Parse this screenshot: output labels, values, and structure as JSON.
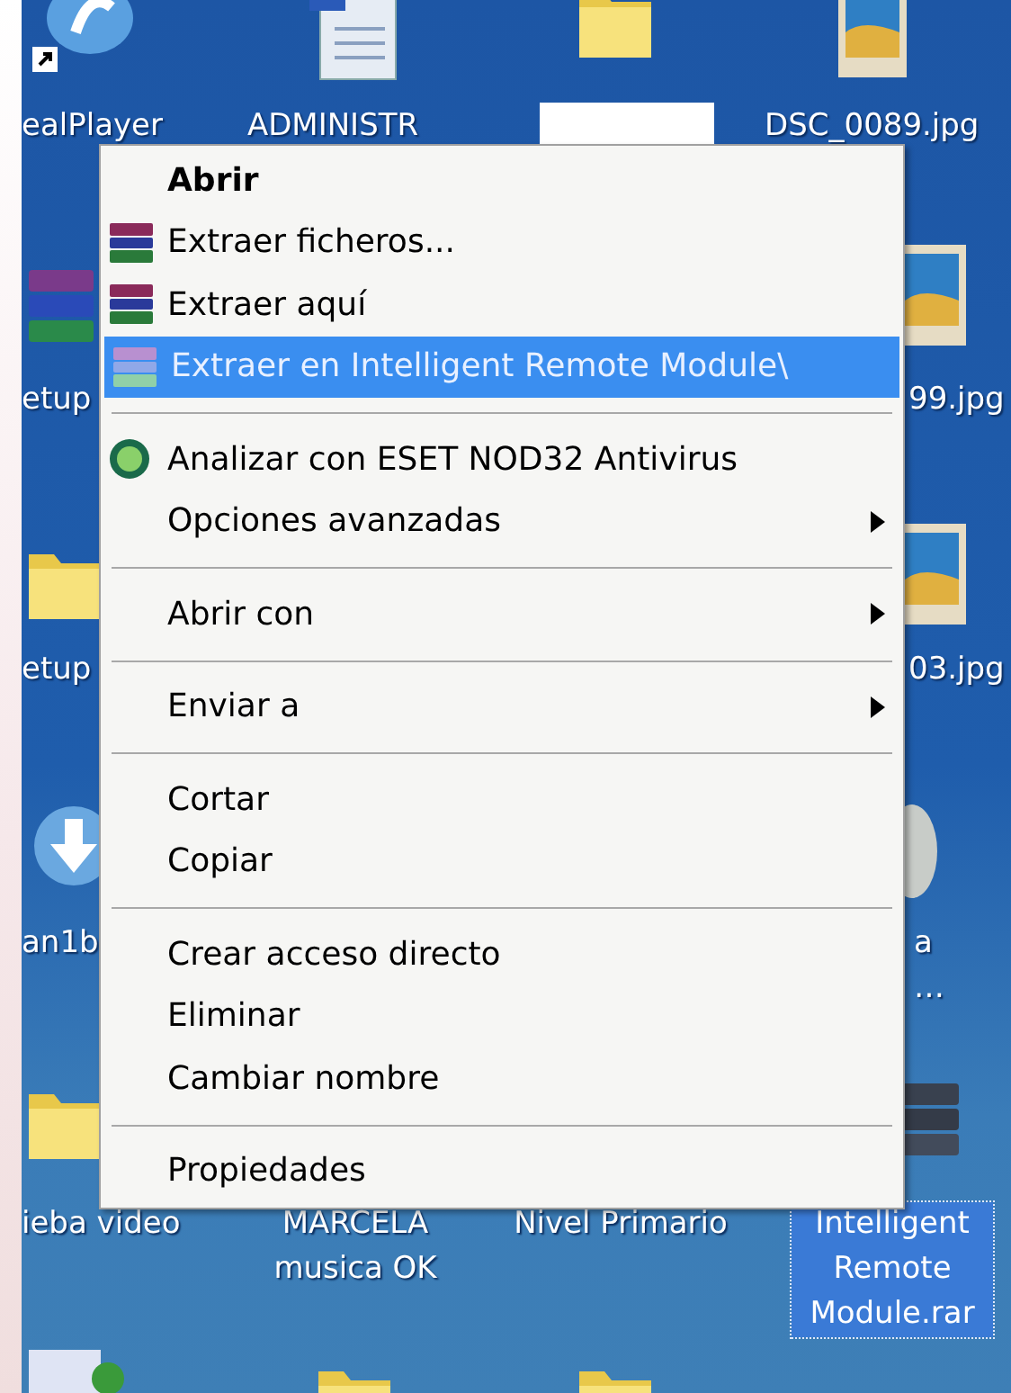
{
  "desktop": {
    "icons": [
      {
        "kind": "media-player",
        "label": "ealPlayer",
        "selected": false
      },
      {
        "kind": "document",
        "label": "ADMINISTR",
        "selected": false
      },
      {
        "kind": "folder",
        "redacted": true,
        "selected": false
      },
      {
        "kind": "photo",
        "label": "DSC_0089.jpg",
        "selected": false
      },
      {
        "kind": "archive",
        "label": "etup",
        "selected": false
      },
      {
        "kind": "photo",
        "label": "99.jpg",
        "selected": false
      },
      {
        "kind": "folder",
        "label": "etup",
        "selected": false
      },
      {
        "kind": "photo",
        "label": "03.jpg",
        "selected": false
      },
      {
        "kind": "download",
        "label": "an1b",
        "selected": false
      },
      {
        "kind": "disc",
        "label": "a\n…",
        "selected": false
      },
      {
        "kind": "folder",
        "label": "ieba video",
        "selected": false
      },
      {
        "kind": "none",
        "label": "MARCELA\nmusica OK",
        "selected": false
      },
      {
        "kind": "none",
        "label": "Nivel Primario",
        "selected": false
      },
      {
        "kind": "archive",
        "label": "Intelligent\nRemote\nModule.rar",
        "selected": true
      },
      {
        "kind": "drive",
        "selected": false
      },
      {
        "kind": "folder",
        "selected": false
      },
      {
        "kind": "folder",
        "selected": false
      }
    ]
  },
  "context_menu": {
    "groups": [
      [
        {
          "kind": "plain",
          "label": "Abrir",
          "default": true,
          "submenu": false,
          "selected": false
        },
        {
          "kind": "extract",
          "label": "Extraer ficheros...",
          "default": false,
          "submenu": false,
          "selected": false
        },
        {
          "kind": "extract",
          "label": "Extraer aquí",
          "default": false,
          "submenu": false,
          "selected": false
        },
        {
          "kind": "extract",
          "label": "Extraer en Intelligent Remote Module\\",
          "default": false,
          "submenu": false,
          "selected": true
        }
      ],
      [
        {
          "kind": "scan",
          "label": "Analizar con ESET NOD32 Antivirus",
          "default": false,
          "submenu": false,
          "selected": false
        },
        {
          "kind": "plain",
          "label": "Opciones avanzadas",
          "default": false,
          "submenu": true,
          "selected": false
        }
      ],
      [
        {
          "kind": "plain",
          "label": "Abrir con",
          "default": false,
          "submenu": true,
          "selected": false
        }
      ],
      [
        {
          "kind": "plain",
          "label": "Enviar a",
          "default": false,
          "submenu": true,
          "selected": false
        }
      ],
      [
        {
          "kind": "plain",
          "label": "Cortar",
          "default": false,
          "submenu": false,
          "selected": false
        },
        {
          "kind": "plain",
          "label": "Copiar",
          "default": false,
          "submenu": false,
          "selected": false
        }
      ],
      [
        {
          "kind": "plain",
          "label": "Crear acceso directo",
          "default": false,
          "submenu": false,
          "selected": false
        },
        {
          "kind": "plain",
          "label": "Eliminar",
          "default": false,
          "submenu": false,
          "selected": false
        },
        {
          "kind": "plain",
          "label": "Cambiar nombre",
          "default": false,
          "submenu": false,
          "selected": false
        }
      ],
      [
        {
          "kind": "plain",
          "label": "Propiedades",
          "default": false,
          "submenu": false,
          "selected": false
        }
      ]
    ]
  }
}
